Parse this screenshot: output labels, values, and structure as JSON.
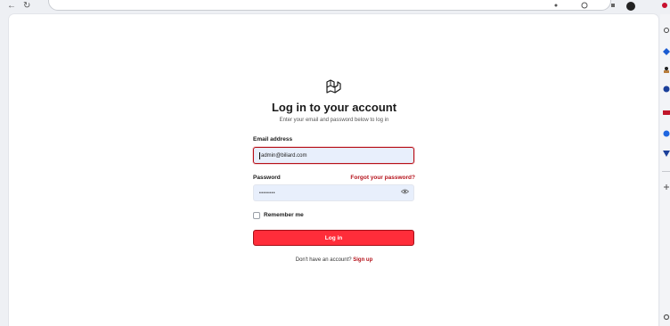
{
  "login": {
    "title": "Log in to your account",
    "subtitle": "Enter your email and password below to log in",
    "email_label": "Email address",
    "email_value": "admin@biliard.com",
    "password_label": "Password",
    "password_masked": "••••••••",
    "forgot_link": "Forgot your password?",
    "remember_label": "Remember me",
    "remember_checked": false,
    "submit_label": "Log in",
    "signup_prompt": "Don't have an account?",
    "signup_link": "Sign up"
  },
  "colors": {
    "accent": "#b5121b",
    "button_fill": "#ff2d3a",
    "input_fill": "#e8effc",
    "page_bg": "#ffffff",
    "chrome_bg": "#eef0f4"
  },
  "icons": {
    "logo": "laravel-logo-icon",
    "password_toggle": "eye-icon"
  }
}
